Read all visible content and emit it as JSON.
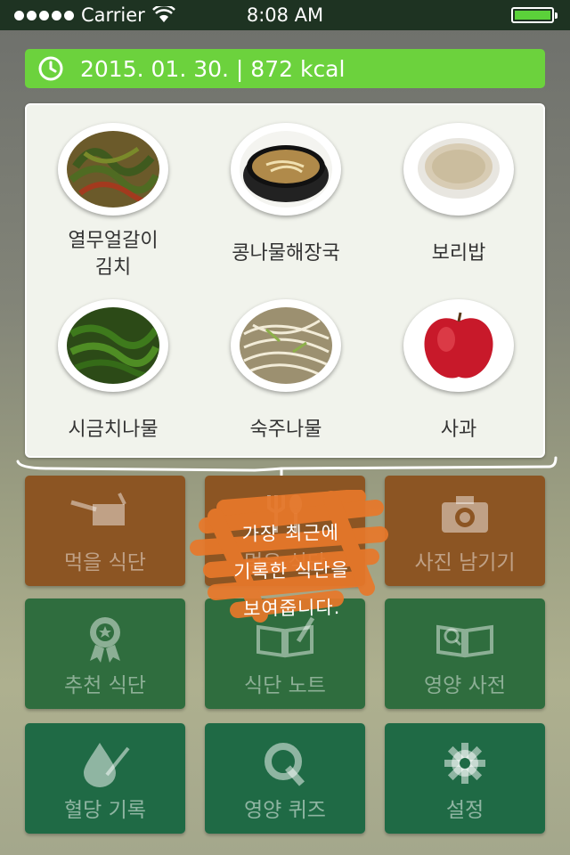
{
  "status_bar": {
    "carrier": "Carrier",
    "time": "8:08 AM"
  },
  "date_bar": {
    "text": "2015. 01. 30. | 872 kcal"
  },
  "foods": [
    {
      "name": "열무얼갈이\n김치",
      "line1": "열무얼갈이",
      "line2": "김치"
    },
    {
      "name": "콩나물해장국"
    },
    {
      "name": "보리밥"
    },
    {
      "name": "시금치나물"
    },
    {
      "name": "숙주나물"
    },
    {
      "name": "사과"
    }
  ],
  "callout": {
    "line1": "가장 최근에",
    "line2": "기록한 식단을",
    "line3": "보여줍니다."
  },
  "menu": [
    {
      "label": "먹을 식단",
      "icon": "pot-icon"
    },
    {
      "label": "먹은 식단",
      "icon": "spoon-fork-icon"
    },
    {
      "label": "사진 남기기",
      "icon": "camera-icon"
    },
    {
      "label": "추천 식단",
      "icon": "award-ribbon-icon"
    },
    {
      "label": "식단 노트",
      "icon": "notebook-pen-icon"
    },
    {
      "label": "영양 사전",
      "icon": "dictionary-icon"
    },
    {
      "label": "혈당 기록",
      "icon": "blood-drop-icon"
    },
    {
      "label": "영양 퀴즈",
      "icon": "quiz-q-icon"
    },
    {
      "label": "설정",
      "icon": "gear-icon"
    }
  ],
  "colors": {
    "date_bar": "#6cd23d",
    "orange_tile": "#8c5523",
    "green_tile": "#22633f"
  }
}
